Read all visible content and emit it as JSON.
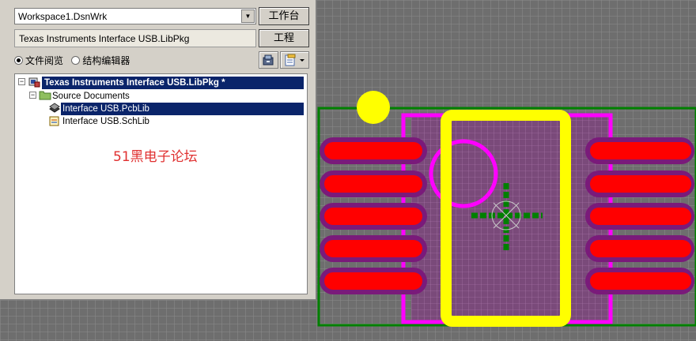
{
  "workspace": {
    "combo_value": "Workspace1.DsnWrk",
    "button_label": "工作台"
  },
  "project": {
    "field_value": "Texas Instruments Interface USB.LibPkg",
    "button_label": "工程"
  },
  "view_options": {
    "file_view_label": "文件阅览",
    "structure_editor_label": "结构编辑器",
    "selected": "file_view"
  },
  "tree": {
    "root_label": "Texas Instruments Interface USB.LibPkg *",
    "folder_label": "Source Documents",
    "files": [
      {
        "label": "Interface USB.PcbLib",
        "selected": true
      },
      {
        "label": "Interface USB.SchLib",
        "selected": false
      }
    ]
  },
  "watermark": "51黑电子论坛",
  "icons": [
    "compile-icon",
    "project-menu-icon",
    "dropdown-arrow-icon",
    "pcb-library-icon",
    "schematic-library-icon",
    "folder-icon",
    "project-package-icon"
  ],
  "colors": {
    "canvas": "#6e6e6e",
    "grid": "#8c8c8c",
    "pad_outer": "#7a1a7a",
    "pad": "#ff0000",
    "silkscreen": "#ffff00",
    "courtyard": "#ff00ff",
    "board_outline": "#008000",
    "origin_marker": "#008000"
  }
}
